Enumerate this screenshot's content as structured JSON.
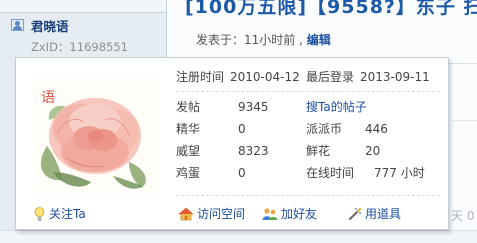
{
  "background": {
    "title_fragment": "[100万五限]【9558?】东子 扫",
    "username": "君晓语",
    "zxid": "ZxID：11698551",
    "post_time": "发表于：11小时前 ",
    "edit_label": "编辑",
    "right_fragment": "天 0"
  },
  "card": {
    "register_label": "注册时间",
    "register_value": "2010-04-12",
    "last_login_label": "最后登录",
    "last_login_value": "2013-09-11",
    "stats": [
      {
        "label": "发帖",
        "value": "9345",
        "right_label": "搜Ta的帖子",
        "right_value": ""
      },
      {
        "label": "精华",
        "value": "0",
        "right_label": "派派币",
        "right_value": "446"
      },
      {
        "label": "威望",
        "value": "8323",
        "right_label": "鲜花",
        "right_value": "20"
      },
      {
        "label": "鸡蛋",
        "value": "0",
        "right_label": "在线时间",
        "right_value": "777 小时"
      }
    ],
    "follow_label": "关注Ta",
    "footer_buttons": [
      "访问空间",
      "加好友",
      "用道具"
    ],
    "avatar_glyph": "语"
  },
  "colors": {
    "link": "#1c4fa0",
    "title": "#1c5aa8"
  }
}
